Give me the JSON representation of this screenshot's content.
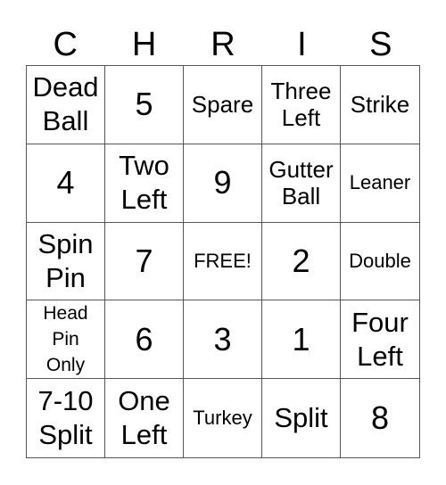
{
  "title_letters": [
    "C",
    "H",
    "R",
    "I",
    "S"
  ],
  "cells": [
    {
      "text": "Dead\nBall",
      "size": "xl"
    },
    {
      "text": "5",
      "size": "num"
    },
    {
      "text": "Spare",
      "size": "md"
    },
    {
      "text": "Three\nLeft",
      "size": "md"
    },
    {
      "text": "Strike",
      "size": "md"
    },
    {
      "text": "4",
      "size": "num"
    },
    {
      "text": "Two\nLeft",
      "size": "xl"
    },
    {
      "text": "9",
      "size": "num"
    },
    {
      "text": "Gutter\nBall",
      "size": "md"
    },
    {
      "text": "Leaner",
      "size": "sm"
    },
    {
      "text": "Spin\nPin",
      "size": "xl"
    },
    {
      "text": "7",
      "size": "num"
    },
    {
      "text": "FREE!",
      "size": "sm"
    },
    {
      "text": "2",
      "size": "num"
    },
    {
      "text": "Double",
      "size": "sm"
    },
    {
      "text": "Head\nPin\nOnly",
      "size": "xs"
    },
    {
      "text": "6",
      "size": "num"
    },
    {
      "text": "3",
      "size": "num"
    },
    {
      "text": "1",
      "size": "num"
    },
    {
      "text": "Four\nLeft",
      "size": "xl"
    },
    {
      "text": "7-10\nSplit",
      "size": "xl"
    },
    {
      "text": "One\nLeft",
      "size": "xl"
    },
    {
      "text": "Turkey",
      "size": "sm"
    },
    {
      "text": "Split",
      "size": "xl"
    },
    {
      "text": "8",
      "size": "num"
    }
  ]
}
